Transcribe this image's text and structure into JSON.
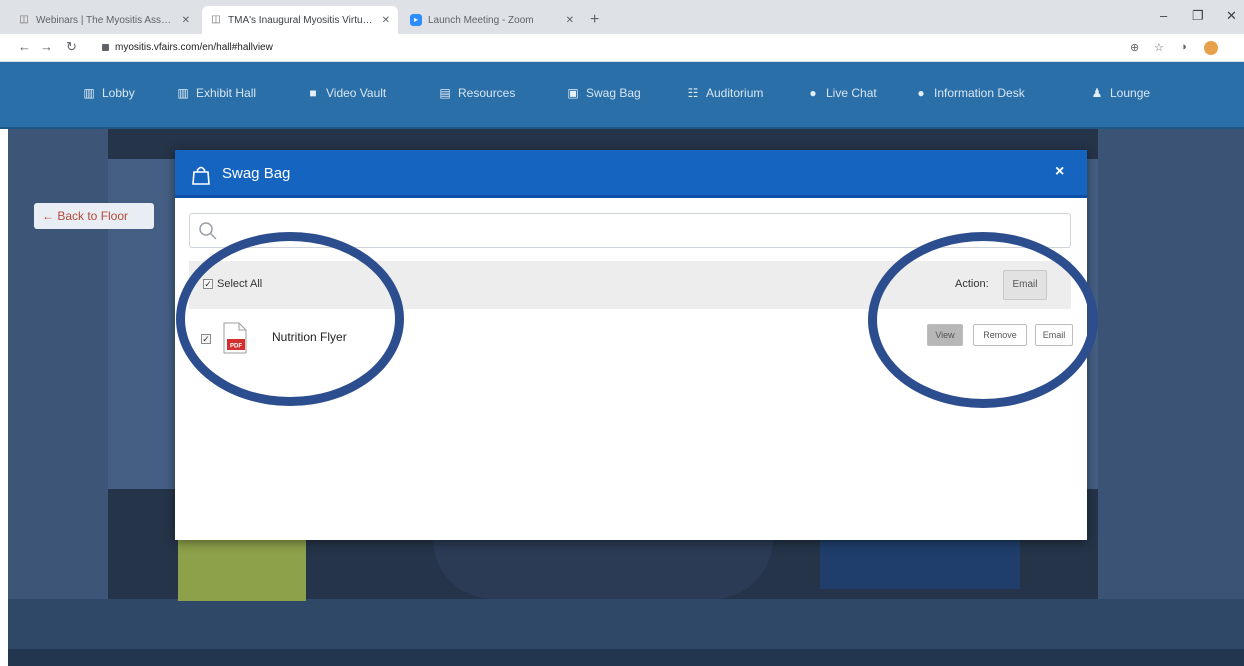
{
  "browser": {
    "tabs": [
      {
        "title": "Webinars | The Myositis Associ...",
        "favicon": "generic-page-icon",
        "active": false
      },
      {
        "title": "TMA's Inaugural Myositis Virtual...",
        "favicon": "generic-page-icon",
        "active": true
      },
      {
        "title": "Launch Meeting - Zoom",
        "favicon": "zoom-icon",
        "active": false
      }
    ],
    "new_tab": "+",
    "url": "myositis.vfairs.com/en/hall#hallview",
    "window_controls": {
      "minimize": "–",
      "maximize": "❐",
      "close": "✕"
    }
  },
  "site_nav": {
    "items": [
      {
        "label": "Lobby",
        "icon": "building-icon"
      },
      {
        "label": "Exhibit Hall",
        "icon": "building-icon"
      },
      {
        "label": "Video Vault",
        "icon": "video-camera-icon"
      },
      {
        "label": "Resources",
        "icon": "folder-icon"
      },
      {
        "label": "Swag Bag",
        "icon": "briefcase-icon"
      },
      {
        "label": "Auditorium",
        "icon": "grid-icon"
      },
      {
        "label": "Live Chat",
        "icon": "chat-icon"
      },
      {
        "label": "Information Desk",
        "icon": "info-icon"
      },
      {
        "label": "Lounge",
        "icon": "users-icon"
      }
    ]
  },
  "stage": {
    "back_to_floor": "← Back to Floor"
  },
  "modal": {
    "title": "Swag Bag",
    "close": "×",
    "search": {
      "placeholder": "",
      "value": ""
    },
    "select_all_label": "Select All",
    "select_all_checked": true,
    "action_label": "Action:",
    "action_email": "Email",
    "items": [
      {
        "name": "Nutrition Flyer",
        "file_type": "PDF",
        "checked": true,
        "buttons": {
          "view": "View",
          "remove": "Remove",
          "email": "Email"
        }
      }
    ]
  },
  "colors": {
    "nav_bar": "#2b6fa8",
    "modal_header": "#1565c0",
    "highlight_ring": "#2c4d8e",
    "pdf_red": "#d32f2f"
  }
}
